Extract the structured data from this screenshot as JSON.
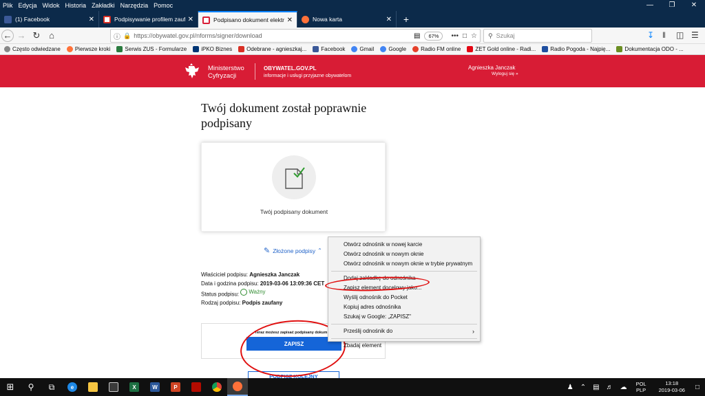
{
  "menubar": {
    "items": [
      "Plik",
      "Edycja",
      "Widok",
      "Historia",
      "Zakładki",
      "Narzędzia",
      "Pomoc"
    ]
  },
  "tabs": [
    {
      "label": "(1) Facebook",
      "icon": "facebook-icon",
      "color": "#3b5998"
    },
    {
      "label": "Podpisywanie profilem zaufanym",
      "icon": "gmail-icon",
      "color": "#d93025"
    },
    {
      "label": "Podpisano dokument elektroniczny",
      "icon": "gov-icon",
      "color": "#d81c35"
    },
    {
      "label": "Nowa karta",
      "icon": "firefox-icon",
      "color": "#ff7139"
    }
  ],
  "navbar": {
    "url": "https://obywatel.gov.pl/nforms/signer/download",
    "zoom": "67%",
    "search_placeholder": "Szukaj"
  },
  "bookmarks": [
    {
      "label": "Często odwiedzane",
      "color": "#888888"
    },
    {
      "label": "Pierwsze kroki",
      "color": "#ff7139"
    },
    {
      "label": "Serwis ZUS - Formularze",
      "color": "#2a7b3f"
    },
    {
      "label": "iPKO Biznes",
      "color": "#003574"
    },
    {
      "label": "Odebrane - agnieszkaj...",
      "color": "#d93025"
    },
    {
      "label": "Facebook",
      "color": "#3b5998"
    },
    {
      "label": "Gmail",
      "color": "#4285f4"
    },
    {
      "label": "Google",
      "color": "#4285f4"
    },
    {
      "label": "Radio FM online",
      "color": "#e5412b"
    },
    {
      "label": "ZET Gold online - Radi...",
      "color": "#e30613"
    },
    {
      "label": "Radio Pogoda - Najpię...",
      "color": "#1f4fa0"
    },
    {
      "label": "Dokumentacja ODO - ...",
      "color": "#6b8e23"
    }
  ],
  "header": {
    "ministry_line1": "Ministerstwo",
    "ministry_line2": "Cyfryzacji",
    "portal": "OBYWATEL.GOV.PL",
    "portal_sub": "informacje i usługi przyjazne obywatelom",
    "user": "Agnieszka Janczak",
    "logout": "Wyloguj się »"
  },
  "main": {
    "heading": "Twój dokument został poprawnie podpisany",
    "document_label": "Twój podpisany dokument",
    "signatures_toggle": "Złożone podpisy",
    "signature": {
      "owner_label": "Właściciel podpisu:",
      "owner": "Agnieszka Janczak",
      "datetime_label": "Data i godzina podpisu:",
      "datetime": "2019-03-06 13:09:36 CET",
      "status_label": "Status podpisu:",
      "status": "Ważny",
      "type_label": "Rodzaj podpisu:",
      "type": "Podpis zaufany"
    },
    "save_hint": "Teraz możesz zapisać podpisany dokum",
    "save_button": "ZAPISZ",
    "sign_again_button": "PODPISZ KOLEJNY"
  },
  "context_menu": {
    "items": [
      "Otwórz odnośnik w nowej karcie",
      "Otwórz odnośnik w nowym oknie",
      "Otwórz odnośnik w nowym oknie w trybie prywatnym",
      "Dodaj zakładkę do odnośnika",
      "Zapisz element docelowy jako...",
      "Wyślij odnośnik do Pocket",
      "Kopiuj adres odnośnika",
      "Szukaj w Google: „ZAPISZ\"",
      "Prześlij odnośnik do",
      "Zbadaj element"
    ]
  },
  "taskbar": {
    "lang1": "POL",
    "lang2": "PLP",
    "time": "13:18",
    "date": "2019-03-06",
    "colors": {
      "edge": "#1e88e5",
      "excel": "#1d6f42",
      "word": "#2b579a",
      "powerpoint": "#d04423",
      "chrome": "#fbbc05",
      "firefox": "#ff7139"
    }
  }
}
